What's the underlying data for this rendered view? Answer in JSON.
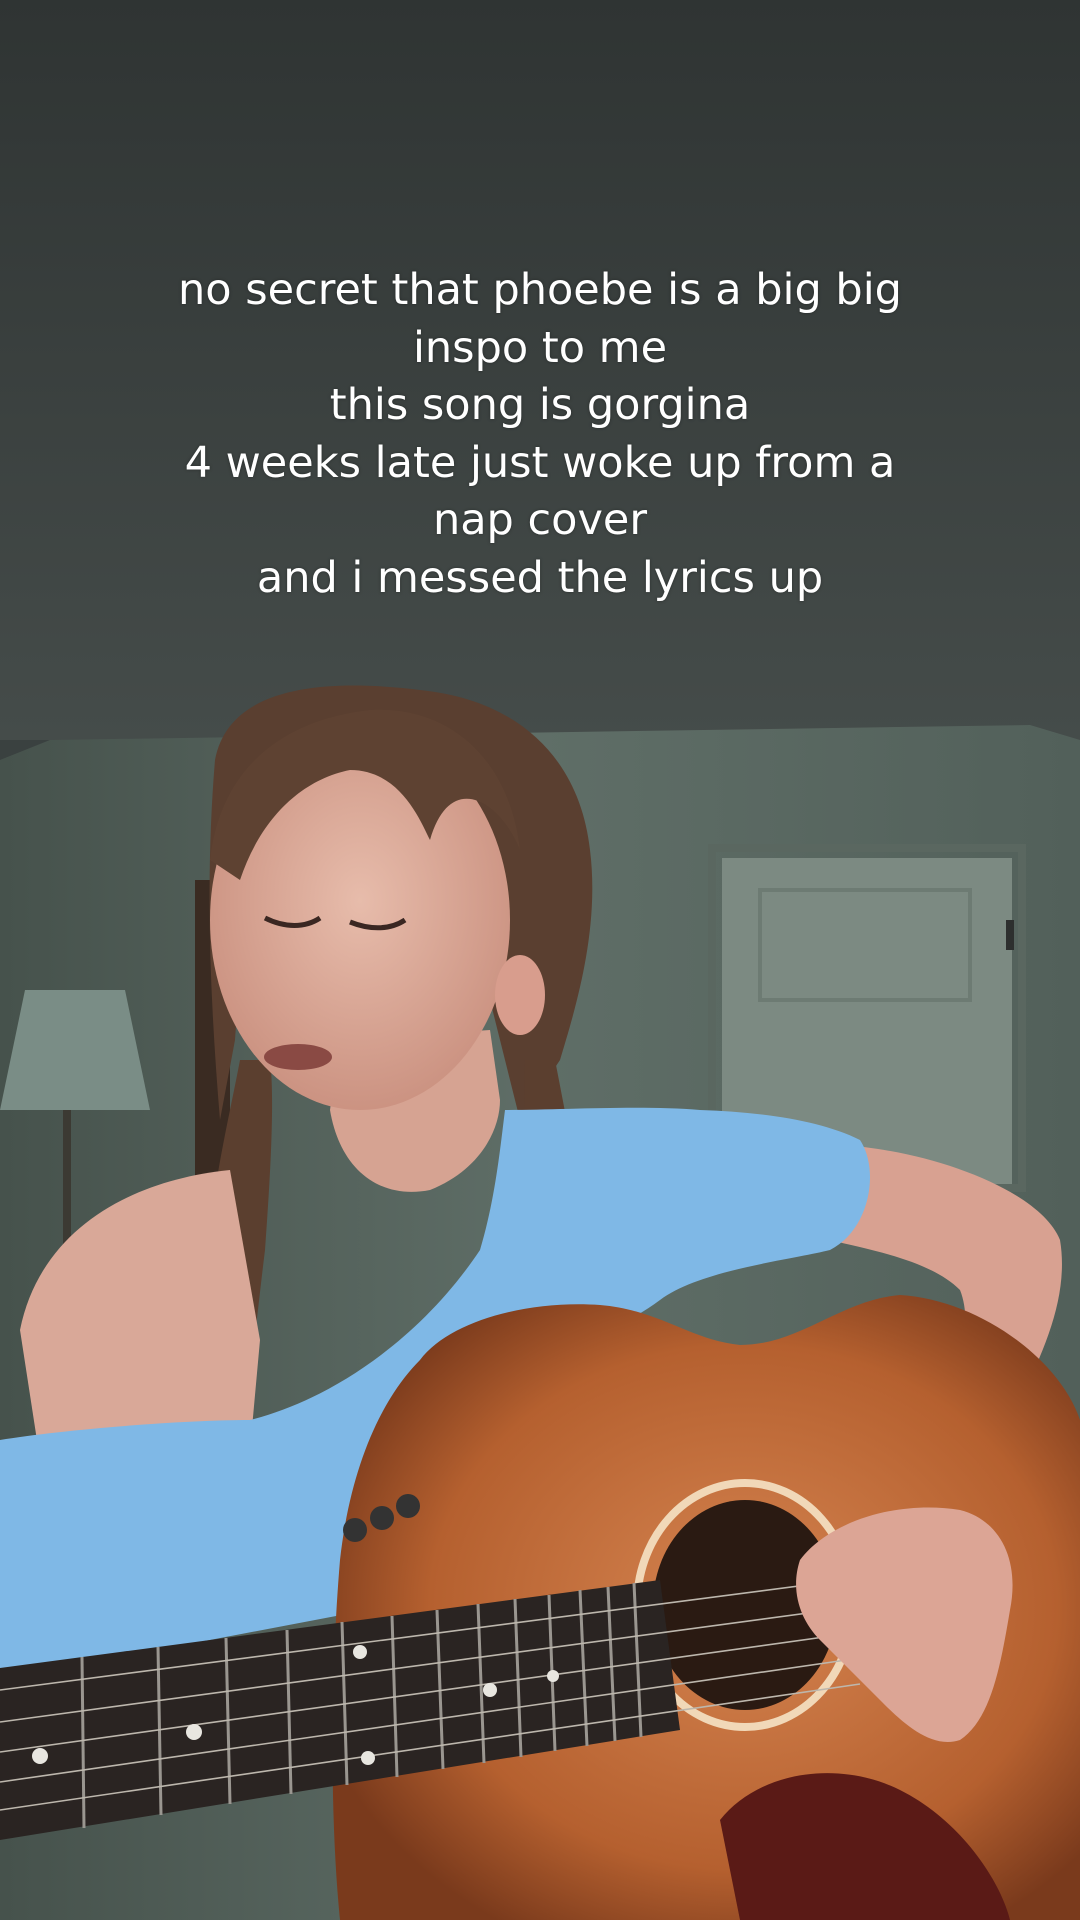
{
  "caption": {
    "lines": [
      "no secret that phoebe is a big big",
      "inspo to me",
      "this song is gorgina",
      "4 weeks late just woke up from a",
      "nap cover",
      "and i messed the lyrics up"
    ]
  },
  "colors": {
    "ceiling": "#3c4241",
    "wall": "#5c6a64",
    "shirt": "#7fb8e6",
    "guitar_body": "#b8653a",
    "fretboard": "#2a2422",
    "skin": "#d9a898",
    "hair": "#5a3f30"
  },
  "photo": {
    "subject": "person-singing-with-guitar"
  }
}
